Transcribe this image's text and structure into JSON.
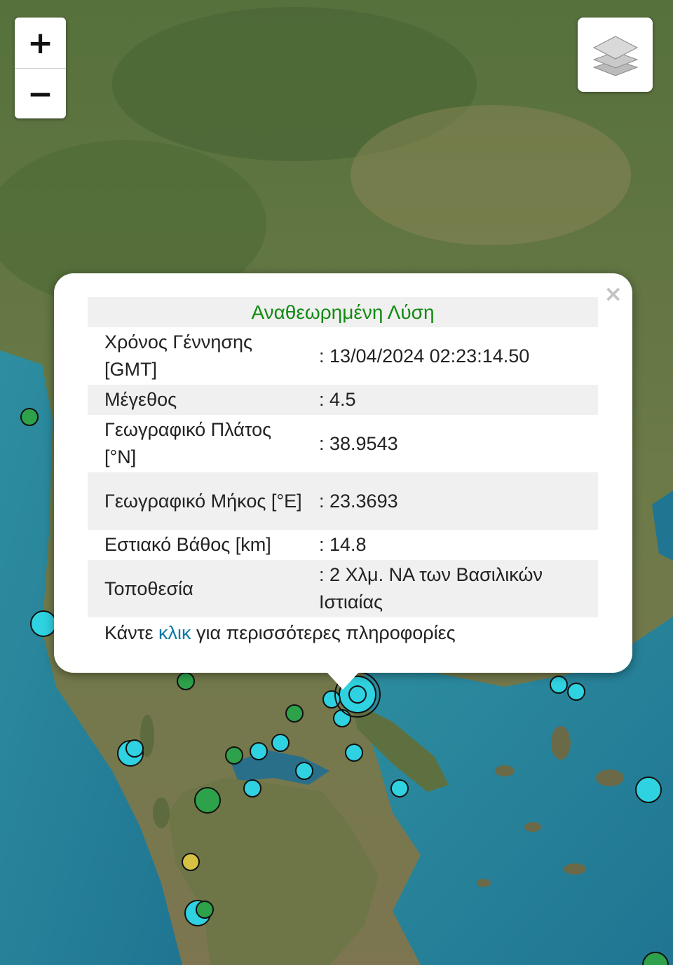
{
  "map": {
    "zoom_in_label": "+",
    "zoom_out_label": "−",
    "layers_icon": "layers-icon",
    "colors": {
      "cyan": "#2fd2e0",
      "green": "#2ea24a",
      "yellow": "#d6c142"
    },
    "markers": [
      {
        "color": "green",
        "size": "small"
      },
      {
        "color": "cyan",
        "size": "medium"
      },
      {
        "color": "green",
        "size": "small"
      },
      {
        "color": "cyan",
        "size": "large"
      },
      {
        "color": "cyan",
        "size": "small"
      },
      {
        "color": "cyan",
        "size": "small"
      },
      {
        "color": "green",
        "size": "small"
      },
      {
        "color": "cyan",
        "size": "small"
      },
      {
        "color": "cyan",
        "size": "small"
      },
      {
        "color": "cyan",
        "size": "small"
      },
      {
        "color": "cyan",
        "size": "medium"
      },
      {
        "color": "cyan",
        "size": "small"
      },
      {
        "color": "green",
        "size": "small"
      },
      {
        "color": "green",
        "size": "medium"
      },
      {
        "color": "cyan",
        "size": "small"
      },
      {
        "color": "cyan",
        "size": "small"
      },
      {
        "color": "cyan",
        "size": "small"
      },
      {
        "color": "cyan",
        "size": "small"
      },
      {
        "color": "cyan",
        "size": "small"
      },
      {
        "color": "cyan",
        "size": "medium"
      },
      {
        "color": "yellow",
        "size": "small"
      },
      {
        "color": "cyan",
        "size": "medium"
      },
      {
        "color": "green",
        "size": "small"
      },
      {
        "color": "green",
        "size": "medium"
      }
    ]
  },
  "popup": {
    "title": "Αναθεωρημένη Λύση",
    "close_label": "×",
    "rows": [
      {
        "label": "Χρόνος Γέννησης [GMT]",
        "value": ": 13/04/2024 02:23:14.50"
      },
      {
        "label": "Μέγεθος",
        "value": ": 4.5"
      },
      {
        "label": "Γεωγραφικό Πλάτος [°N]",
        "value": ": 38.9543"
      },
      {
        "label": "Γεωγραφικό Μήκος [°E]",
        "value": ": 23.3693"
      },
      {
        "label": "Εστιακό Βάθος [km]",
        "value": ": 14.8"
      },
      {
        "label": "Τοποθεσία",
        "value": ": 2 Χλμ. ΝΑ των Βασιλικών Ιστιαίας"
      }
    ],
    "footer_pre": "Κάντε ",
    "footer_link": "κλικ",
    "footer_post": " για περισσότερες πληροφορίες"
  }
}
